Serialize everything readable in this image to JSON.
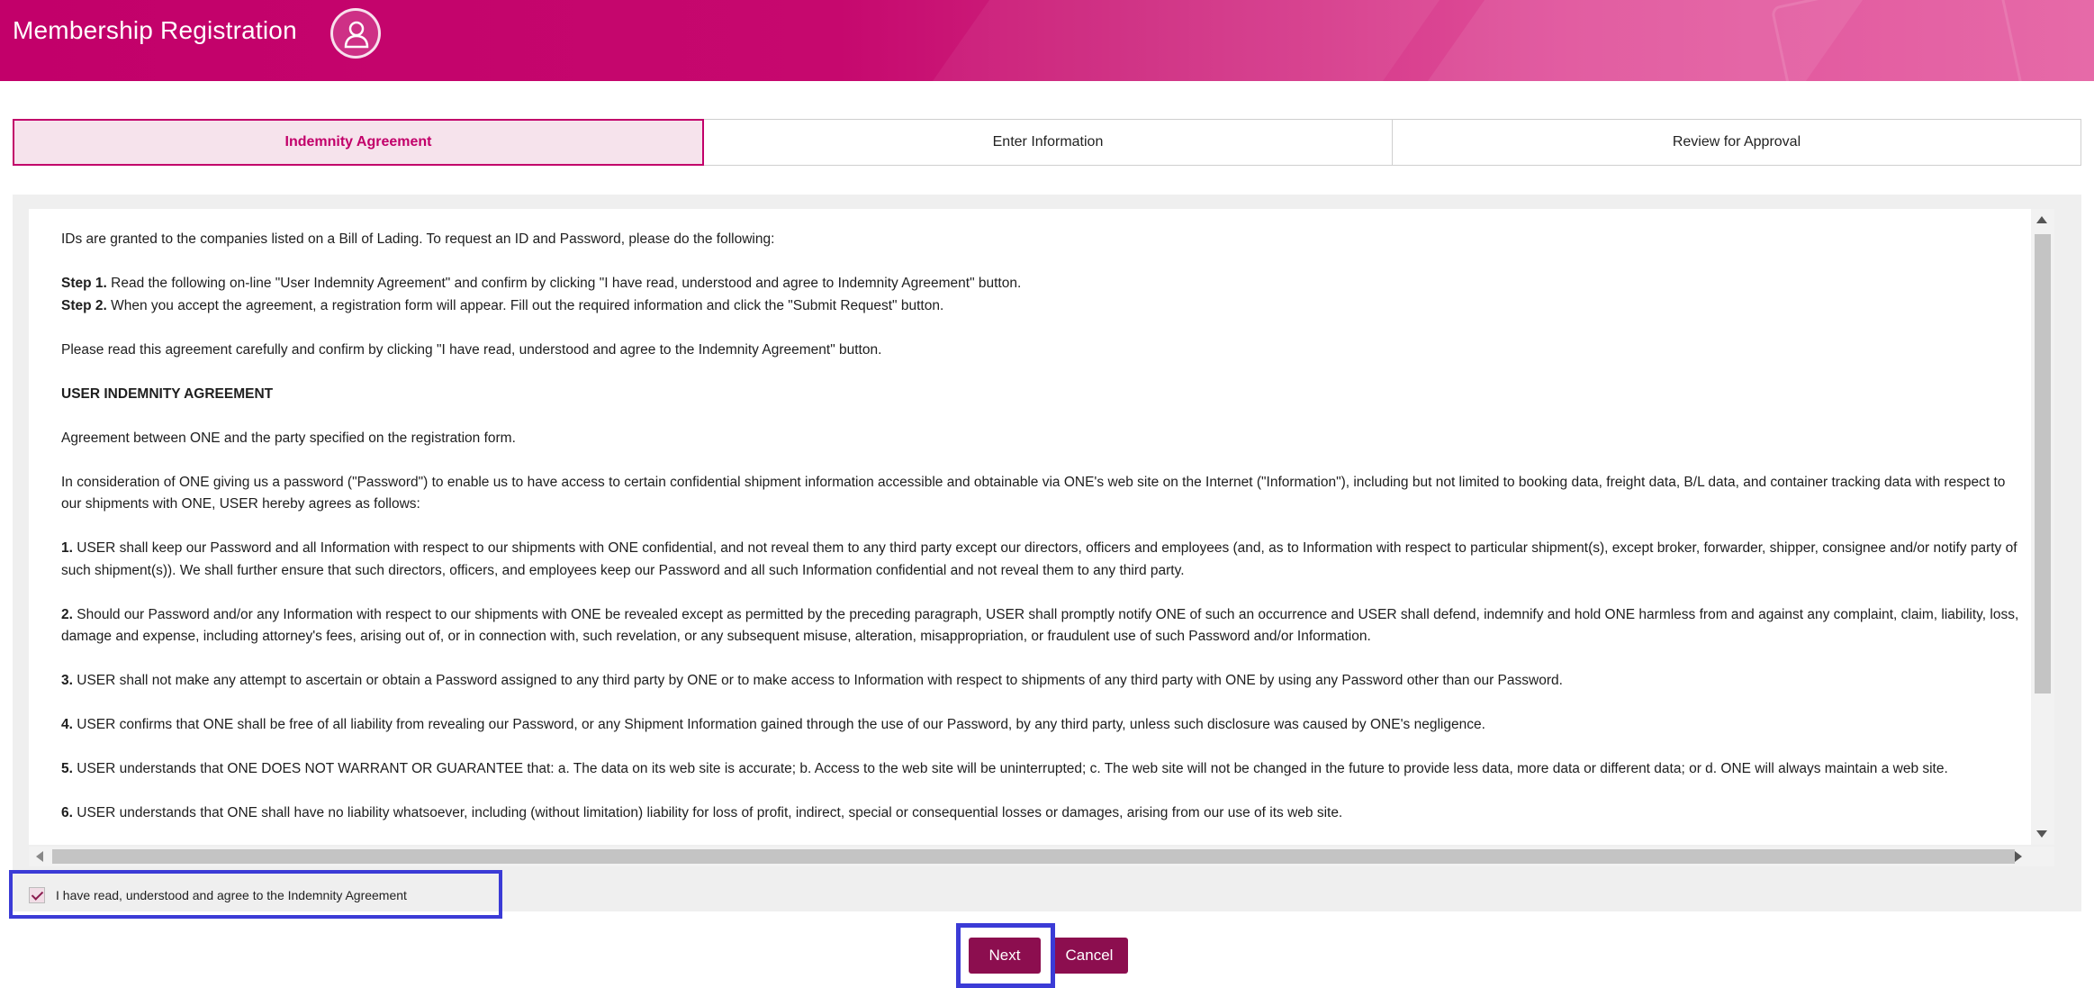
{
  "header": {
    "title": "Membership Registration",
    "avatar_icon": "user-icon"
  },
  "tabs": [
    {
      "label": "Indemnity Agreement",
      "active": true
    },
    {
      "label": "Enter Information",
      "active": false
    },
    {
      "label": "Review for Approval",
      "active": false
    }
  ],
  "agreement": {
    "intro": "IDs are granted to the companies listed on a Bill of Lading. To request an ID and Password, please do the following:",
    "step1_label": "Step 1.",
    "step1_text": " Read the following on-line \"User Indemnity Agreement\" and confirm by clicking \"I have read, understood and agree to Indemnity Agreement\" button.",
    "step2_label": "Step 2.",
    "step2_text": " When you accept the agreement, a registration form will appear. Fill out the required information and click the \"Submit Request\" button.",
    "please_read": "Please read this agreement carefully and confirm by clicking \"I have read, understood and agree to the Indemnity Agreement\" button.",
    "heading": "USER INDEMNITY AGREEMENT",
    "between": "Agreement between ONE and the party specified on the registration form.",
    "consideration": " In consideration of ONE giving us a password (\"Password\") to enable us to have access to certain confidential shipment information accessible and obtainable via ONE's web site on the Internet (\"Information\"), including but not limited to booking data, freight data, B/L data, and container tracking data with respect to our shipments with ONE, USER hereby agrees as follows:",
    "clauses": [
      {
        "num": "1.",
        "text": " USER shall keep our Password and all Information with respect to our shipments with ONE confidential, and not reveal them to any third party except our directors, officers and employees (and, as to Information with respect to particular shipment(s), except broker, forwarder, shipper, consignee and/or notify party of such shipment(s)). We shall further ensure that such directors, officers, and employees keep our Password and all such Information confidential and not reveal them to any third party."
      },
      {
        "num": "2.",
        "text": " Should our Password and/or any Information with respect to our shipments with ONE be revealed except as permitted by the preceding paragraph, USER shall promptly notify ONE of such an occurrence and USER shall defend, indemnify and hold ONE harmless from and against any complaint, claim, liability, loss, damage and expense, including attorney's fees, arising out of, or in connection with, such revelation, or any subsequent misuse, alteration, misappropriation, or fraudulent use of such Password and/or Information."
      },
      {
        "num": "3.",
        "text": " USER shall not make any attempt to ascertain or obtain a Password assigned to any third party by ONE or to make access to Information with respect to shipments of any third party with ONE by using any Password other than our Password."
      },
      {
        "num": "4.",
        "text": " USER confirms that ONE shall be free of all liability from revealing our Password, or any Shipment Information gained through the use of our Password, by any third party, unless such disclosure was caused by ONE's negligence."
      },
      {
        "num": "5.",
        "text": " USER understands that ONE DOES NOT WARRANT OR GUARANTEE that: a. The data on its web site is accurate; b. Access to the web site will be uninterrupted; c. The web site will not be changed in the future to provide less data, more data or different data; or d. ONE will always maintain a web site."
      },
      {
        "num": "6.",
        "text": " USER understands that ONE shall have no liability whatsoever, including (without limitation) liability for loss of profit, indirect, special or consequential losses or damages, arising from our use of its web site."
      }
    ]
  },
  "agree_checkbox": {
    "label": "I have read, understood and agree to the Indemnity Agreement",
    "checked": true
  },
  "buttons": {
    "next": "Next",
    "cancel": "Cancel"
  },
  "colors": {
    "brand": "#c2006a",
    "button": "#8c0e4f",
    "highlight": "#3b3bd6"
  }
}
